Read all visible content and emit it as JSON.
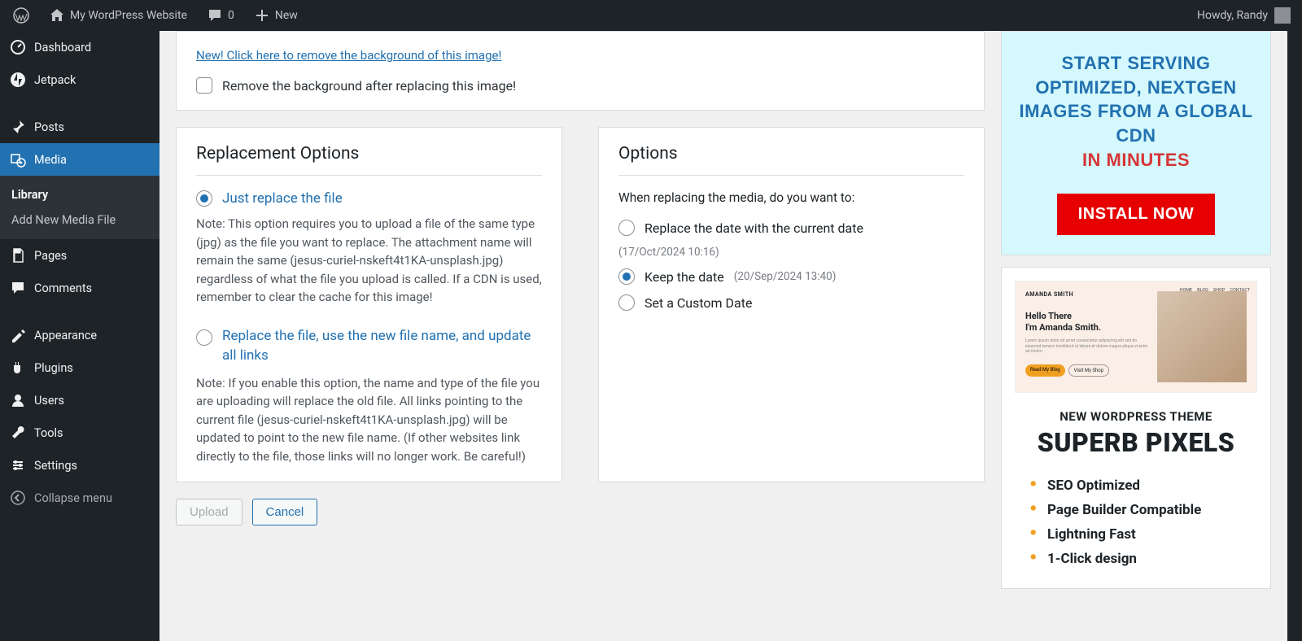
{
  "adminbar": {
    "site_name": "My WordPress Website",
    "comments_count": "0",
    "new_label": "New",
    "howdy": "Howdy, Randy"
  },
  "sidebar": {
    "items": [
      {
        "label": "Dashboard",
        "icon": "dashboard"
      },
      {
        "label": "Jetpack",
        "icon": "jetpack"
      },
      {
        "label": "Posts",
        "icon": "pin"
      },
      {
        "label": "Media",
        "icon": "media",
        "active": true,
        "sub": [
          {
            "label": "Library",
            "current": true
          },
          {
            "label": "Add New Media File"
          }
        ]
      },
      {
        "label": "Pages",
        "icon": "pages"
      },
      {
        "label": "Comments",
        "icon": "comments"
      },
      {
        "label": "Appearance",
        "icon": "appearance"
      },
      {
        "label": "Plugins",
        "icon": "plugins"
      },
      {
        "label": "Users",
        "icon": "users"
      },
      {
        "label": "Tools",
        "icon": "tools"
      },
      {
        "label": "Settings",
        "icon": "settings"
      }
    ],
    "collapse": "Collapse menu"
  },
  "bg": {
    "link": "New! Click here to remove the background of this image!",
    "checkbox_label": "Remove the background after replacing this image!"
  },
  "replace": {
    "heading": "Replacement Options",
    "opt1": "Just replace the file",
    "note1": "Note: This option requires you to upload a file of the same type (jpg) as the file you want to replace. The attachment name will remain the same (jesus-curiel-nskeft4t1KA-unsplash.jpg) regardless of what the file you upload is called. If a CDN is used, remember to clear the cache for this image!",
    "opt2": "Replace the file, use the new file name, and update all links",
    "note2": "Note: If you enable this option, the name and type of the file you are uploading will replace the old file. All links pointing to the current file (jesus-curiel-nskeft4t1KA-unsplash.jpg) will be updated to point to the new file name. (If other websites link directly to the file, those links will no longer work. Be careful!)"
  },
  "options": {
    "heading": "Options",
    "question": "When replacing the media, do you want to:",
    "r1": "Replace the date with the current date",
    "r1_meta": "(17/Oct/2024 10:16)",
    "r2": "Keep the date",
    "r2_meta": "(20/Sep/2024 13:40)",
    "r3": "Set a Custom Date"
  },
  "buttons": {
    "upload": "Upload",
    "cancel": "Cancel"
  },
  "promo1": {
    "line1": "START SERVING OPTIMIZED, NEXTGEN IMAGES FROM A GLOBAL CDN",
    "line2": "IN MINUTES",
    "cta": "INSTALL NOW"
  },
  "promo2": {
    "preview_name": "AMANDA SMITH",
    "preview_hello1": "Hello There",
    "preview_hello2": "I'm Amanda Smith.",
    "tag": "NEW WORDPRESS THEME",
    "name": "SUPERB PIXELS",
    "features": [
      "SEO Optimized",
      "Page Builder Compatible",
      "Lightning Fast",
      "1-Click design"
    ]
  }
}
